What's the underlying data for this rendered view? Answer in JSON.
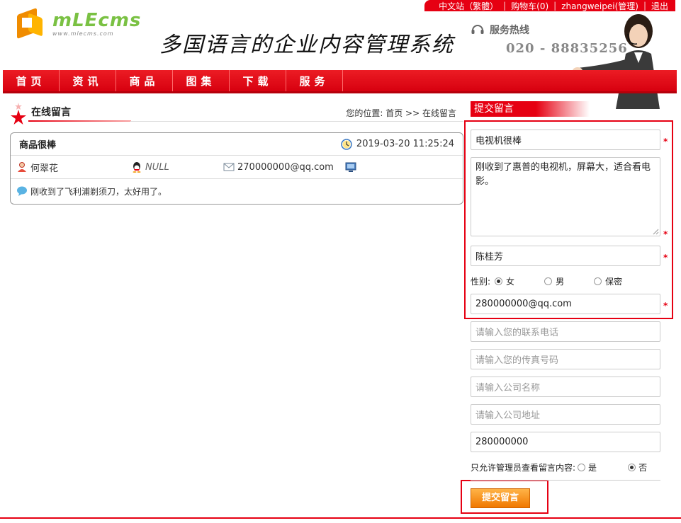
{
  "topbar": {
    "items": [
      "中文站（繁體）",
      "购物车(0)",
      "zhangweipei(管理)",
      "退出"
    ]
  },
  "header": {
    "logo_main": "mLEcms",
    "logo_sub": "www.mlecms.com",
    "slogan": "多国语言的企业内容管理系统",
    "hotline_label": "服务热线",
    "hotline_number": "020 - 88835256"
  },
  "nav": {
    "items": [
      "首页",
      "资讯",
      "商品",
      "图集",
      "下载",
      "服务"
    ]
  },
  "left": {
    "section_title": "在线留言",
    "breadcrumb_prefix": "您的位置:",
    "breadcrumb_home": "首页",
    "breadcrumb_sep": ">>",
    "breadcrumb_current": "在线留言",
    "message": {
      "subject": "商品很棒",
      "datetime": "2019-03-20 11:25:24",
      "name": "何翠花",
      "qq": "NULL",
      "email": "270000000@qq.com",
      "content": "刚收到了飞利浦剃须刀，太好用了。"
    }
  },
  "form": {
    "header": "提交留言",
    "title_value": "电视机很棒",
    "content_value": "刚收到了惠普的电视机，屏幕大，适合看电影。",
    "name_value": "陈桂芳",
    "gender_label": "性别:",
    "gender_options": [
      "女",
      "男",
      "保密"
    ],
    "gender_selected": "女",
    "email_value": "280000000@qq.com",
    "phone_placeholder": "请输入您的联系电话",
    "fax_placeholder": "请输入您的传真号码",
    "company_placeholder": "请输入公司名称",
    "address_placeholder": "请输入公司地址",
    "qq_value": "280000000",
    "admin_only_label": "只允许管理员查看留言内容:",
    "admin_only_options": [
      "是",
      "否"
    ],
    "admin_only_selected": "否",
    "required_mark": "*",
    "submit_label": "提交留言"
  },
  "colors": {
    "brand_red": "#e60012",
    "button_orange": "#f07800"
  }
}
